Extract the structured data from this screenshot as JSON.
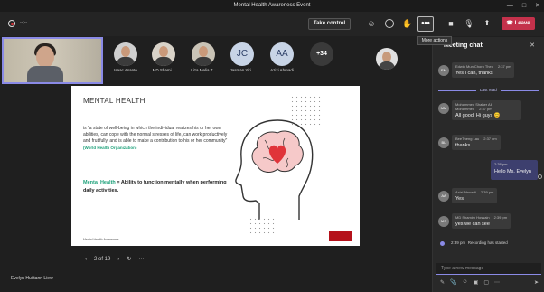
{
  "window": {
    "title": "Mental Health Awareness Event"
  },
  "toolbar": {
    "timer": "--:--",
    "take_control": "Take control",
    "more_label": "•••",
    "leave_label": "Leave",
    "more_tooltip": "More actions"
  },
  "participants": [
    {
      "name": "Isaac Asante",
      "kind": "photo"
    },
    {
      "name": "MD Shami...",
      "kind": "photo"
    },
    {
      "name": "Liza Melia T...",
      "kind": "photo"
    },
    {
      "name": "Jasman Yiri...",
      "kind": "initials",
      "initials": "JC"
    },
    {
      "name": "Azizi Ahmadi",
      "kind": "initials",
      "initials": "AA"
    },
    {
      "name": "",
      "kind": "more",
      "initials": "+34"
    }
  ],
  "slide": {
    "title": "MENTAL HEALTH",
    "definition": "is \"a state of well-being in which the individual realizes his or her own abilities, can cope with the normal stresses of life, can work productively and fruitfully, and is able to make a contribution to his or her community\"",
    "source": "(World Health Organization)",
    "mh_term": "Mental Health",
    "mh_rest": "= Ability to function mentally when performing daily activities.",
    "footer": "Mental Health Awareness",
    "page": "2 of 19"
  },
  "presenter": "Evelyn Huittann Liew",
  "chat": {
    "title": "Meeting chat",
    "last_read": "Last read",
    "messages": [
      {
        "sender": "Edwin Mun Chorn Theo",
        "time": "2:37 pm",
        "text": "Yes I can, thanks",
        "initials": "EM"
      },
      {
        "sender": "Mohammed Shaher Ali Mohammed",
        "time": "2:37 pm",
        "text": "All good. Hi guys 😊",
        "initials": "MM"
      },
      {
        "sender": "BeeTheng Lau",
        "time": "2:37 pm",
        "text": "thanks",
        "initials": "BL"
      },
      {
        "sender": "Azizi Ahmadi",
        "time": "2:39 pm",
        "text": "Yes",
        "initials": "AA"
      },
      {
        "sender": "MD Shamim Hossain",
        "time": "2:39 pm",
        "text": "yes we can see",
        "initials": "MS"
      }
    ],
    "mine": {
      "time": "2:38 pm",
      "text": "Hello Ms. Evelyn"
    },
    "system": {
      "time": "2:39 pm",
      "text": "Recording has started"
    },
    "compose_placeholder": "Type a new message"
  }
}
